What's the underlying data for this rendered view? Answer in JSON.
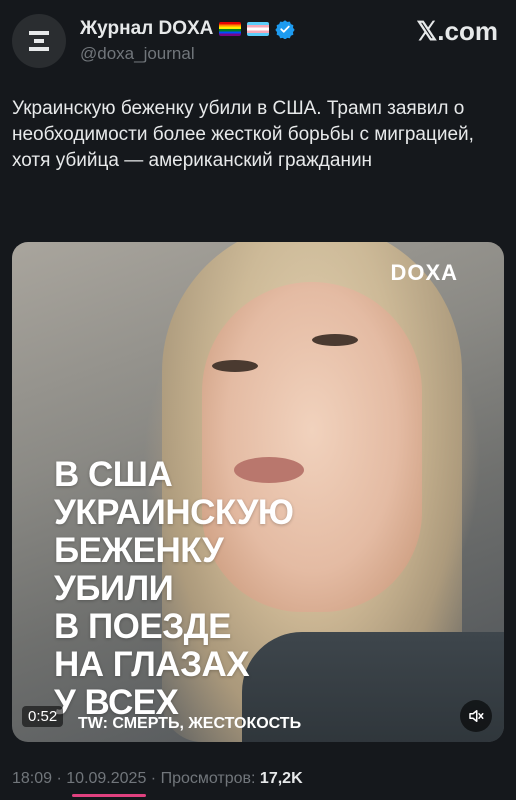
{
  "account": {
    "name": "Журнал DOXA",
    "handle": "@doxa_journal",
    "avatar_icon": "doxa-logo-icon",
    "flags": [
      "rainbow-flag-icon",
      "transgender-flag-icon"
    ],
    "verified_icon": "verified-badge-icon"
  },
  "platform": {
    "logo": "𝕏.com"
  },
  "tweet": {
    "text": "Украинскую беженку убили в США. Трамп заявил о необходимости более жесткой борьбы с миграцией, хотя убийца — американский гражданин"
  },
  "media": {
    "brand": "DOXA",
    "headline_lines": [
      "В США",
      "УКРАИНСКУЮ",
      "БЕЖЕНКУ",
      "УБИЛИ",
      "В ПОЕЗДЕ",
      "НА ГЛАЗАХ",
      "У ВСЕХ"
    ],
    "content_warning": "TW: СМЕРТЬ, ЖЕСТОКОСТЬ",
    "timer": "0:52",
    "mute_icon": "speaker-muted-icon"
  },
  "meta": {
    "time": "18:09",
    "sep1": " · ",
    "date": "10.09.2025",
    "sep2": " · ",
    "views_label": "Просмотров: ",
    "views_count": "17,2K"
  },
  "colors": {
    "background": "#15181c",
    "text": "#e7e9ea",
    "secondary": "#71767b",
    "verified": "#1d9bf0",
    "highlight_underline": "#e0417f"
  }
}
